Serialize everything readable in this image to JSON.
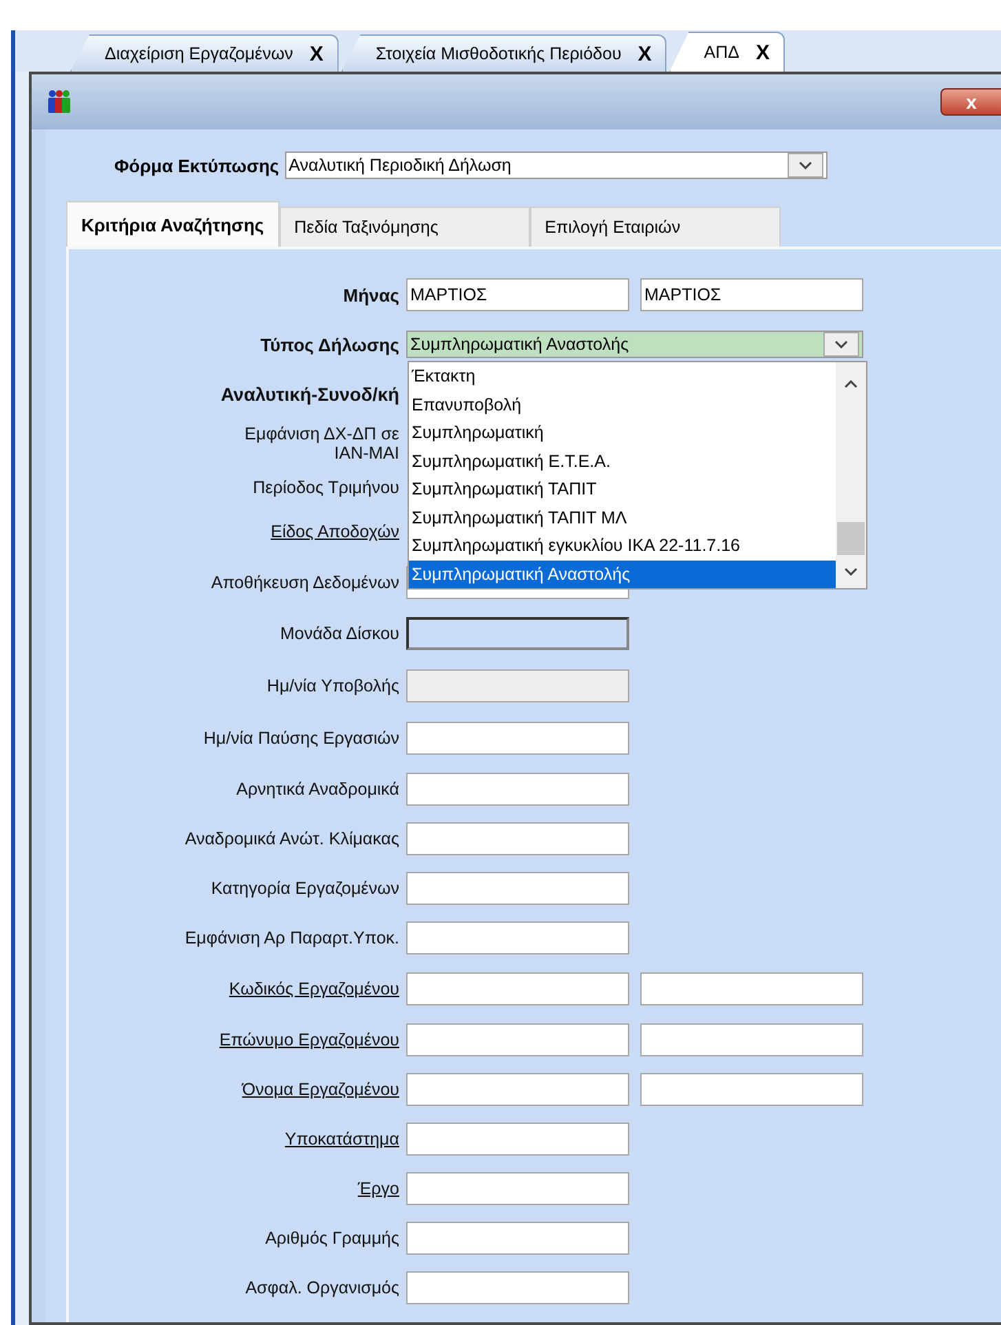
{
  "doc_tabs": [
    {
      "label": "Διαχείριση Εργαζομένων",
      "close": "X",
      "selected": false
    },
    {
      "label": "Στοιχεία Μισθοδοτικής Περιόδου",
      "close": "X",
      "selected": false
    },
    {
      "label": "ΑΠΔ",
      "close": "X",
      "selected": true
    }
  ],
  "dialog": {
    "close": "x"
  },
  "print_form": {
    "label": "Φόρμα Εκτύπωσης",
    "value": "Αναλυτική Περιοδική Δήλωση"
  },
  "tabs": [
    {
      "label": "Κριτήρια Αναζήτησης",
      "selected": true
    },
    {
      "label": "Πεδία Ταξινόμησης",
      "selected": false
    },
    {
      "label": "Επιλογή Εταιριών",
      "selected": false
    }
  ],
  "rows": [
    {
      "label": "Μήνας",
      "kind": "bold",
      "fields": [
        {
          "kind": "text",
          "value": "ΜΑΡΤΙΟΣ"
        },
        {
          "kind": "text",
          "value": "ΜΑΡΤΙΟΣ"
        }
      ]
    },
    {
      "label": "Τύπος Δήλωσης",
      "kind": "bold",
      "fields": [
        {
          "kind": "combo",
          "value": "Συμπληρωματική Αναστολής",
          "options": [
            {
              "label": "Έκτακτη",
              "selected": false
            },
            {
              "label": "Επανυποβολή",
              "selected": false
            },
            {
              "label": "Συμπληρωματική",
              "selected": false
            },
            {
              "label": "Συμπληρωματική Ε.Τ.Ε.Α.",
              "selected": false
            },
            {
              "label": "Συμπληρωματική ΤΑΠΙΤ",
              "selected": false
            },
            {
              "label": "Συμπληρωματική ΤΑΠΙΤ ΜΛ",
              "selected": false
            },
            {
              "label": "Συμπληρωματική εγκυκλίου ΙΚΑ 22-11.7.16",
              "selected": false
            },
            {
              "label": "Συμπληρωματική Αναστολής",
              "selected": true
            }
          ]
        }
      ]
    },
    {
      "label": "Αναλυτική-Συνοδ/κή",
      "kind": "heading",
      "fields": []
    },
    {
      "label": "Εμφάνιση ΔΧ-ΔΠ σε ΙΑΝ-ΜΑΙ",
      "kind": "wrapped",
      "fields": []
    },
    {
      "label": "Περίοδος Τριμήνου",
      "kind": "plain",
      "fields": []
    },
    {
      "label": "Είδος Αποδοχών",
      "kind": "link",
      "fields": []
    },
    {
      "label": "Αποθήκευση Δεδομένων",
      "kind": "plain",
      "fields": [
        {
          "kind": "text"
        }
      ]
    },
    {
      "label": "Μονάδα Δίσκου",
      "kind": "plain",
      "fields": [
        {
          "kind": "sunken"
        }
      ]
    },
    {
      "label": "Ημ/νία Υποβολής",
      "kind": "plain",
      "fields": [
        {
          "kind": "disabled"
        }
      ]
    },
    {
      "label": "Ημ/νία Παύσης Εργασιών",
      "kind": "plain",
      "fields": [
        {
          "kind": "text"
        }
      ]
    },
    {
      "label": "Αρνητικά Αναδρομικά",
      "kind": "plain",
      "fields": [
        {
          "kind": "text"
        }
      ]
    },
    {
      "label": "Αναδρομικά Ανώτ. Κλίμακας",
      "kind": "plain",
      "fields": [
        {
          "kind": "text"
        }
      ]
    },
    {
      "label": "Κατηγορία Εργαζομένων",
      "kind": "plain",
      "fields": [
        {
          "kind": "text"
        }
      ]
    },
    {
      "label": "Εμφάνιση Αρ Παραρτ.Υποκ.",
      "kind": "plain",
      "fields": [
        {
          "kind": "text"
        }
      ]
    },
    {
      "label": "Κωδικός Εργαζομένου",
      "kind": "link",
      "fields": [
        {
          "kind": "text"
        },
        {
          "kind": "text"
        }
      ]
    },
    {
      "label": "Επώνυμο Εργαζομένου",
      "kind": "link",
      "fields": [
        {
          "kind": "text"
        },
        {
          "kind": "text"
        }
      ]
    },
    {
      "label": "Όνομα Εργαζομένου",
      "kind": "link",
      "fields": [
        {
          "kind": "text"
        },
        {
          "kind": "text"
        }
      ]
    },
    {
      "label": "Υποκατάστημα",
      "kind": "link",
      "fields": [
        {
          "kind": "text"
        }
      ]
    },
    {
      "label": "Έργο",
      "kind": "link",
      "fields": [
        {
          "kind": "text"
        }
      ]
    },
    {
      "label": "Αριθμός Γραμμής",
      "kind": "plain",
      "fields": [
        {
          "kind": "text"
        }
      ]
    },
    {
      "label": "Ασφαλ. Οργανισμός",
      "kind": "plain",
      "fields": [
        {
          "kind": "text"
        }
      ]
    }
  ]
}
